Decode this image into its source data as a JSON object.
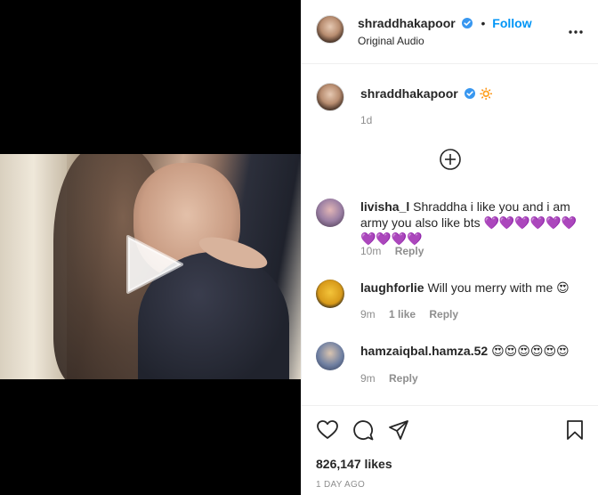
{
  "post": {
    "author": "shraddhakapoor",
    "verified": true,
    "follow_label": "Follow",
    "separator": "•",
    "audio": "Original Audio",
    "caption_emoji": "🔅",
    "caption_age": "1d",
    "likes": "826,147 likes",
    "posted": "1 DAY AGO"
  },
  "comments": [
    {
      "user": "livisha_l",
      "text": "Shraddha i like you and i am army you also like bts 💜💜💜💜💜💜💜💜💜💜",
      "age": "10m",
      "likes": "",
      "reply_label": "Reply"
    },
    {
      "user": "laughforlie",
      "text": "Will you merry with me 😍",
      "age": "9m",
      "likes": "1 like",
      "reply_label": "Reply"
    },
    {
      "user": "hamzaiqbal.hamza.52",
      "text": "😍😍😍😍😍😍",
      "age": "9m",
      "likes": "",
      "reply_label": "Reply"
    }
  ],
  "icons": {
    "play": "play-icon",
    "more": "more-options-icon",
    "add": "add-circle-icon",
    "like": "heart-icon",
    "comment": "comment-icon",
    "share": "send-icon",
    "save": "bookmark-icon",
    "verified": "verified-badge-icon"
  },
  "colors": {
    "accent": "#0095f6",
    "muted": "#8e8e8e",
    "text": "#262626"
  }
}
